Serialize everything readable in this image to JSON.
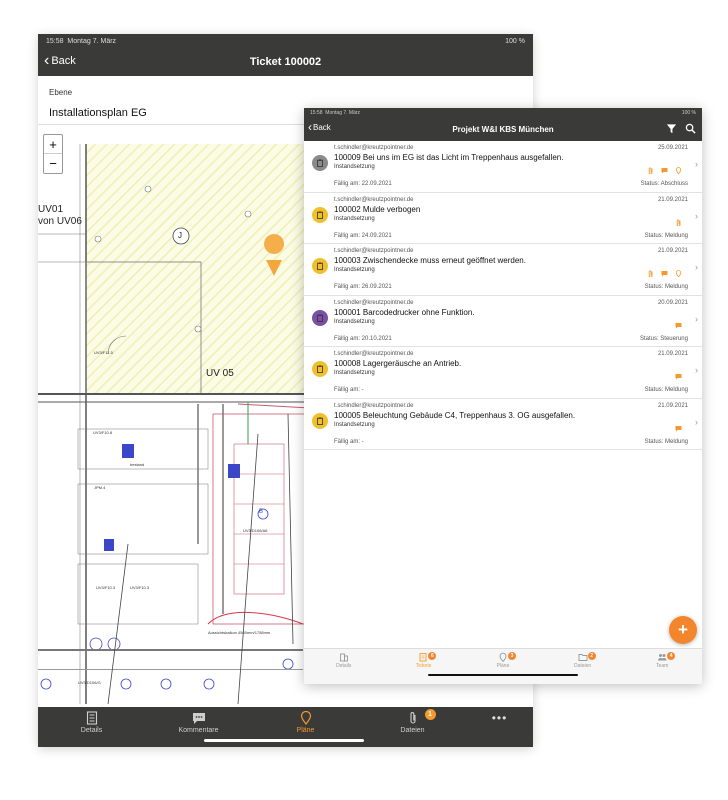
{
  "ticket_view": {
    "status_bar": {
      "time": "15:58",
      "date": "Montag 7. März",
      "battery": "100 %"
    },
    "nav": {
      "back_label": "Back",
      "title": "Ticket 100002"
    },
    "ebene_label": "Ebene",
    "ebene_value": "Installationsplan EG",
    "zoom": {
      "in": "+",
      "out": "−"
    },
    "plan_labels": {
      "uv01": "UV01",
      "von_uv06": "von UV06",
      "uv05": "UV 05",
      "j": "J",
      "b": "B",
      "bestand": "bestand"
    },
    "tabs": [
      {
        "label": "Details",
        "icon": "document-icon"
      },
      {
        "label": "Kommentare",
        "icon": "comment-icon"
      },
      {
        "label": "Pläne",
        "icon": "pin-icon"
      },
      {
        "label": "Dateien",
        "icon": "paperclip-icon",
        "badge": "1"
      }
    ],
    "more_label": "•••"
  },
  "project_view": {
    "status_bar": {
      "time": "15:58",
      "date": "Montag 7. März",
      "battery": "100 %"
    },
    "nav": {
      "back_label": "Back",
      "title": "Projekt W&I KBS München"
    },
    "tickets": [
      {
        "email": "t.schindler@kreutzpointner.de",
        "date": "25.09.2021",
        "title": "100009 Bei uns im EG ist das Licht im Treppenhaus ausgefallen.",
        "category": "Instandsetzung",
        "due": "Fällig am: 22.09.2021",
        "status": "Status: Abschluss",
        "color": "#8a8a8a",
        "marks": [
          "paperclip-icon",
          "comment-icon",
          "pin-icon"
        ]
      },
      {
        "email": "t.schindler@kreutzpointner.de",
        "date": "21.09.2021",
        "title": "100002 Mulde verbogen",
        "category": "Instandsetzung",
        "due": "Fällig am: 24.09.2021",
        "status": "Status: Meldung",
        "color": "#f0c02c",
        "marks": [
          "paperclip-icon"
        ]
      },
      {
        "email": "t.schindler@kreutzpointner.de",
        "date": "21.09.2021",
        "title": "100003 Zwischendecke muss erneut geöffnet werden.",
        "category": "Instandsetzung",
        "due": "Fällig am: 26.09.2021",
        "status": "Status: Meldung",
        "color": "#f0c02c",
        "marks": [
          "paperclip-icon",
          "comment-icon",
          "pin-icon"
        ]
      },
      {
        "email": "t.schindler@kreutzpointner.de",
        "date": "20.09.2021",
        "title": "100001 Barcodedrucker ohne Funktion.",
        "category": "Instandsetzung",
        "due": "Fällig am: 20.10.2021",
        "status": "Status: Steuerung",
        "color": "#7b4fa3",
        "marks": [
          "comment-icon"
        ]
      },
      {
        "email": "t.schindler@kreutzpointner.de",
        "date": "21.09.2021",
        "title": "100008 Lagergeräusche an Antrieb.",
        "category": "Instandsetzung",
        "due": "Fällig am: -",
        "status": "Status: Meldung",
        "color": "#f0c02c",
        "marks": [
          "comment-icon"
        ]
      },
      {
        "email": "t.schindler@kreutzpointner.de",
        "date": "21.09.2021",
        "title": "100005 Beleuchtung Gebäude C4, Treppenhaus 3. OG ausgefallen.",
        "category": "Instandsetzung",
        "due": "Fällig am: -",
        "status": "Status: Meldung",
        "color": "#f0c02c",
        "marks": [
          "comment-icon"
        ]
      }
    ],
    "fab_label": "+",
    "tabs": [
      {
        "label": "Details",
        "icon": "building-icon"
      },
      {
        "label": "Tickets",
        "icon": "ticket-icon",
        "badge": "6"
      },
      {
        "label": "Pläne",
        "icon": "pin-icon",
        "badge": "3"
      },
      {
        "label": "Dateien",
        "icon": "folder-icon",
        "badge": "2"
      },
      {
        "label": "Team",
        "icon": "team-icon",
        "badge": "4"
      }
    ]
  },
  "colors": {
    "bar": "#3a3a39",
    "accent": "#f39a2c",
    "fab": "#f3862c"
  }
}
